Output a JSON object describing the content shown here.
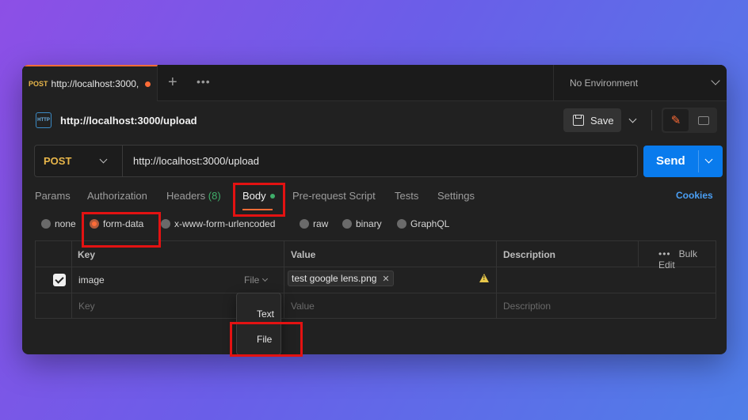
{
  "tab": {
    "method": "POST",
    "title": "http://localhost:3000,"
  },
  "environment": {
    "label": "No Environment"
  },
  "request": {
    "title": "http://localhost:3000/upload",
    "icon_text": "HTTP"
  },
  "toolbar": {
    "save_label": "Save"
  },
  "url_bar": {
    "method": "POST",
    "url": "http://localhost:3000/upload",
    "send_label": "Send"
  },
  "request_tabs": [
    {
      "label": "Params"
    },
    {
      "label": "Authorization"
    },
    {
      "label": "Headers",
      "count": "(8)"
    },
    {
      "label": "Body"
    },
    {
      "label": "Pre-request Script"
    },
    {
      "label": "Tests"
    },
    {
      "label": "Settings"
    }
  ],
  "cookies_label": "Cookies",
  "body_types": [
    {
      "label": "none"
    },
    {
      "label": "form-data",
      "selected": true
    },
    {
      "label": "x-www-form-urlencoded"
    },
    {
      "label": "raw"
    },
    {
      "label": "binary"
    },
    {
      "label": "GraphQL"
    }
  ],
  "table": {
    "headers": {
      "key": "Key",
      "value": "Value",
      "description": "Description",
      "bulk_edit": "Bulk Edit"
    },
    "row": {
      "key": "image",
      "type": "File",
      "file": "test google lens.png"
    },
    "placeholders": {
      "key": "Key",
      "value": "Value",
      "description": "Description"
    }
  },
  "type_dropdown": {
    "options": [
      "Text",
      "File"
    ]
  },
  "icons": {
    "save": "save-icon",
    "edit": "pencil-icon",
    "comment": "comment-icon",
    "warning": "warning-icon"
  },
  "colors": {
    "accent": "#ff6c37",
    "send": "#097bed",
    "method": "#e8b64a",
    "highlight": "#e31212"
  }
}
